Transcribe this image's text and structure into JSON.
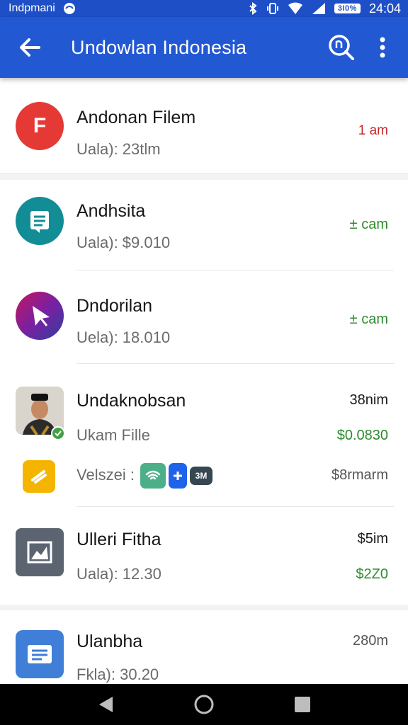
{
  "status_bar": {
    "carrier": "Indpmani",
    "battery_label": "3I0%",
    "time": "24:04"
  },
  "app_bar": {
    "title": "Undowlan Indonesia"
  },
  "items": [
    {
      "title": "Andonan Filem",
      "subtitle": "Uala): 23tlm",
      "meta": "1 am",
      "avatar_letter": "F",
      "avatar_color": "#e53935",
      "meta_color": "#c62828"
    },
    {
      "title": "Andhsita",
      "subtitle": "Uala): $9.010",
      "meta": "± cam",
      "avatar_color": "#0f8a93",
      "meta_color": "#2e8b2e"
    },
    {
      "title": "Dndorilan",
      "subtitle": "Uela): 18.010",
      "meta": "± cam",
      "meta_color": "#2e8b2e"
    },
    {
      "title": "Undaknobsan",
      "subtitle": "Ukam Fille",
      "meta_top": "38nim",
      "meta_bottom": "$0.0830"
    },
    {
      "label": "Velszei :",
      "chip_label": "3M",
      "meta": "$8rmarm"
    },
    {
      "title": "Ulleri Fitha",
      "subtitle": "Uala): 12.30",
      "meta_top": "$5im",
      "meta_bottom": "$2Z0"
    },
    {
      "title": "Ulanbha",
      "subtitle": "Fkla): 30.20",
      "meta": "280m"
    }
  ],
  "colors": {
    "app_bar": "#2358d3",
    "status_bar": "#1e4fc7",
    "positive": "#2e8b2e",
    "alert": "#c62828"
  }
}
